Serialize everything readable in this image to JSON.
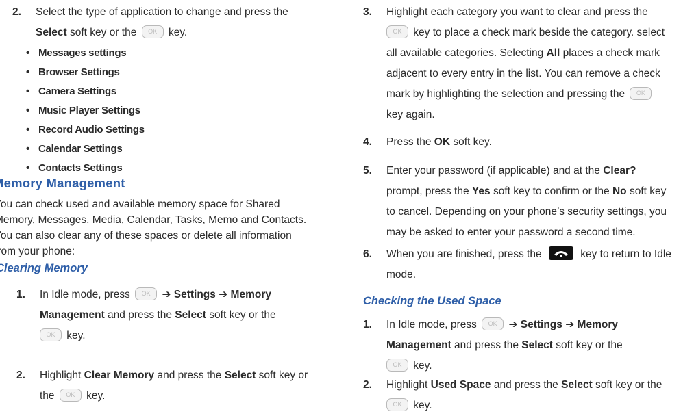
{
  "colors": {
    "heading": "#2f5fa8",
    "text": "#2b2b2b",
    "key_border": "#b9b9b9"
  },
  "icons": {
    "ok_key": "ok-key-icon",
    "end_key": "end-key-icon"
  },
  "ok_label": "OK",
  "left": {
    "step2": {
      "num": "2.",
      "t1": "Select the type of application to change and press the",
      "select": "Select",
      "t2": " soft key or the ",
      "t3": " key."
    },
    "bullets": [
      "Messages settings",
      "Browser Settings",
      "Camera Settings",
      "Music Player Settings",
      "Record Audio Settings",
      "Calendar Settings",
      "Contacts Settings"
    ],
    "heading": "Memory Management",
    "para": [
      "You can check used and available memory space for Shared",
      "Memory, Messages, Media, Calendar, Tasks, Memo and Contacts.",
      "You can also clear any of these spaces or delete all information",
      "from your phone:"
    ],
    "subheading": "Clearing Memory",
    "cm_step1": {
      "num": "1.",
      "t1": "In Idle mode, press ",
      "arrow": "➔",
      "settings": "Settings",
      "memory": "Memory",
      "management": "Management",
      "t2": " and press the ",
      "select": "Select",
      "t3": " soft key or the",
      "t4": " key."
    },
    "cm_step2": {
      "num": "2.",
      "t1": "Highlight ",
      "clear_memory": "Clear Memory",
      "t2": " and press the ",
      "select": "Select",
      "t3": " soft key or",
      "t4": "the ",
      "t5": " key."
    }
  },
  "right": {
    "step3": {
      "num": "3.",
      "l1": "Highlight each category you want to clear and press the",
      "l2": " key to place a check mark beside the category. select",
      "l3a": "all available categories. Selecting ",
      "all": "All",
      "l3b": " places a check mark",
      "l4": "adjacent to every entry in the list. You can remove a check",
      "l5": "mark by highlighting the selection and pressing the ",
      "l6": "key again."
    },
    "step4": {
      "num": "4.",
      "t1": "Press the ",
      "ok": "OK",
      "t2": " soft key."
    },
    "step5": {
      "num": "5.",
      "l1a": "Enter your password (if applicable) and at the ",
      "clear": "Clear?",
      "l2a": "prompt, press the ",
      "yes": "Yes",
      "l2b": " soft key to confirm or the ",
      "no": "No",
      "l2c": " soft key",
      "l3": "to cancel. Depending on your phone’s security settings, you",
      "l4": "may be asked to enter your password a second time."
    },
    "step6": {
      "num": "6.",
      "l1a": "When you are finished, press the ",
      "l1b": " key to return to Idle",
      "l2": "mode."
    },
    "subheading": "Checking the Used Space",
    "cu_step1": {
      "num": "1.",
      "t1": "In Idle mode, press ",
      "arrow": "➔",
      "settings": "Settings",
      "memory": "Memory",
      "management": "Management",
      "t2": " and press the ",
      "select": "Select",
      "t3": " soft key or the",
      "t4": " key."
    },
    "cu_step2": {
      "num": "2.",
      "t1": "Highlight ",
      "used_space": "Used Space",
      "t2": " and press the ",
      "select": "Select",
      "t3": " soft key or the",
      "t4": " key."
    }
  }
}
